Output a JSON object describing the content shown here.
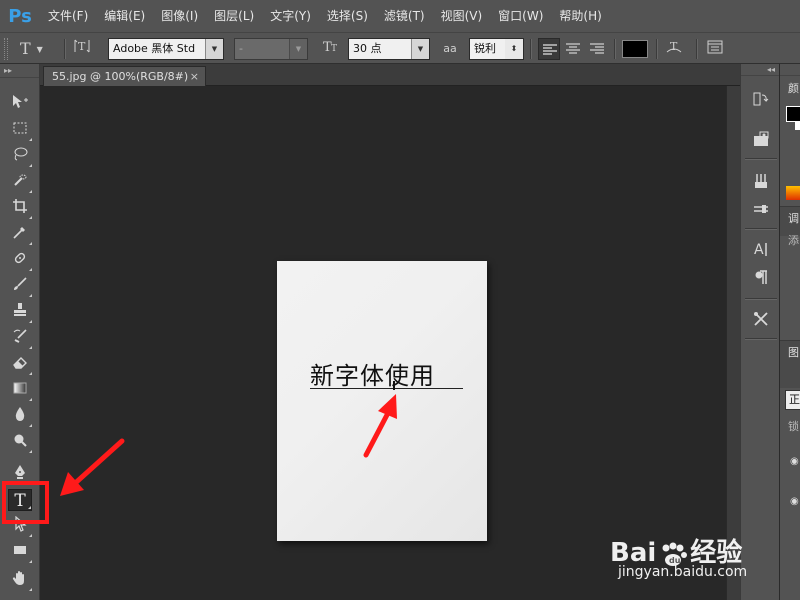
{
  "app": {
    "logo": "Ps",
    "menu": [
      "文件(F)",
      "编辑(E)",
      "图像(I)",
      "图层(L)",
      "文字(Y)",
      "选择(S)",
      "滤镜(T)",
      "视图(V)",
      "窗口(W)",
      "帮助(H)"
    ]
  },
  "options_bar": {
    "tool_icon": "T",
    "orientation_icon": "text-orientation-icon",
    "font_family": "Adobe 黑体 Std",
    "font_style": "-",
    "font_size": "30 点",
    "antialias_icon": "aa",
    "antialias": "锐利",
    "text_color": "#000000",
    "alignment": "left"
  },
  "document": {
    "tab_title": "55.jpg @ 100%(RGB/8#)",
    "tab_close": "×",
    "text": "新字体使用"
  },
  "toolbar": {
    "collapse": "▸▸",
    "active_tool": "type-tool",
    "type_tool_label": "T"
  },
  "right_panel": {
    "collapse": "◂◂",
    "labels": [
      "颜",
      "调",
      "添",
      "图",
      "锁"
    ],
    "field": "正"
  },
  "annotation": {
    "color": "#ff1a1a"
  },
  "watermark": {
    "brand": "Bai",
    "brand_suffix": "经验",
    "url": "jingyan.baidu.com"
  }
}
